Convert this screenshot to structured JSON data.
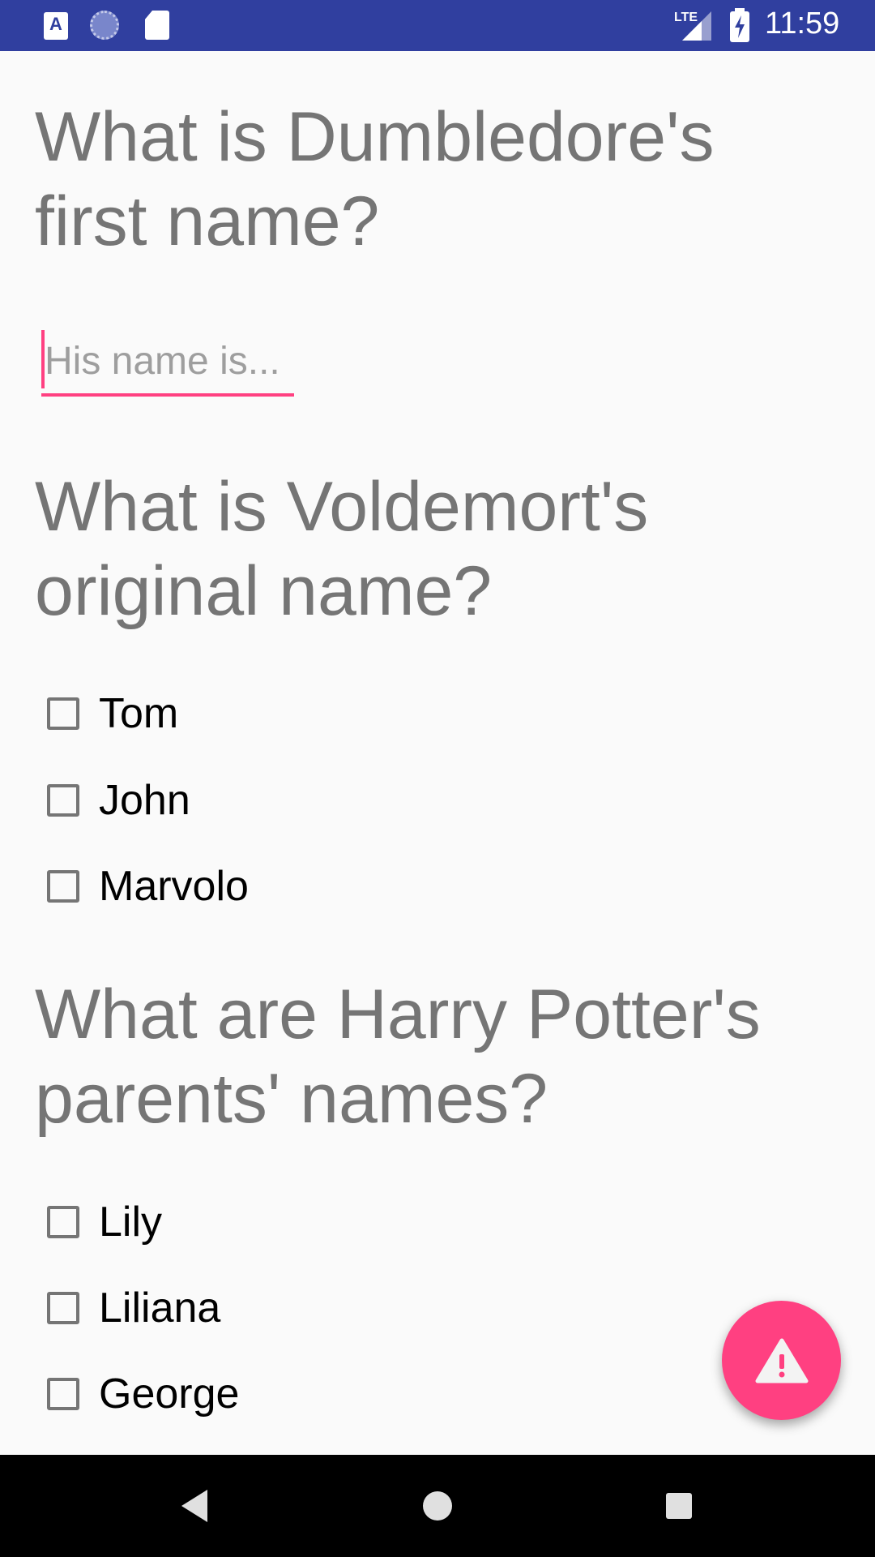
{
  "status_bar": {
    "time": "11:59",
    "network": "LTE",
    "icons": [
      "accessibility-app-icon",
      "sync-icon",
      "sd-card-icon",
      "lte-signal-icon",
      "battery-charging-icon"
    ],
    "background_color": "#303f9f"
  },
  "quiz": {
    "q1": {
      "question": "What is Dumbledore's first name?",
      "answer_value": "",
      "answer_placeholder": "His name is..."
    },
    "q2": {
      "question": "What is Voldemort's original name?",
      "options": [
        {
          "label": "Tom",
          "checked": false
        },
        {
          "label": "John",
          "checked": false
        },
        {
          "label": "Marvolo",
          "checked": false
        }
      ]
    },
    "q3": {
      "question": "What are Harry Potter's parents' names?",
      "options": [
        {
          "label": "Lily",
          "checked": false
        },
        {
          "label": "Liliana",
          "checked": false
        },
        {
          "label": "George",
          "checked": false
        }
      ]
    }
  },
  "fab": {
    "icon": "warning-icon",
    "color": "#ff4081"
  },
  "nav_bar": {
    "buttons": [
      "back-icon",
      "home-icon",
      "recents-icon"
    ]
  },
  "colors": {
    "accent": "#ff4081",
    "question_text": "#757575",
    "primary_dark": "#303f9f"
  }
}
